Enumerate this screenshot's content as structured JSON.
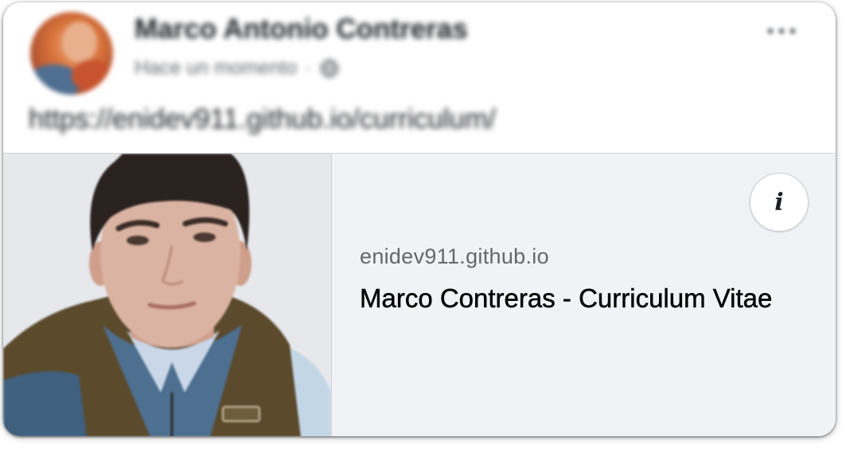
{
  "post": {
    "author_name": "Marco Antonio Contreras",
    "timestamp": "Hace un momento",
    "separator": "·",
    "audience_icon": "globe-icon",
    "more_icon": "more-options-icon",
    "text": "https://enidev911.github.io/curriculum/"
  },
  "link_preview": {
    "image": "profile-photo",
    "domain": "enidev911.github.io",
    "title": "Marco Contreras - Curriculum Vitae",
    "info_icon_glyph": "i"
  },
  "colors": {
    "card_background": "#ffffff",
    "preview_background": "#f0f2f5",
    "secondary_text": "#65676b",
    "primary_text": "#050505"
  }
}
